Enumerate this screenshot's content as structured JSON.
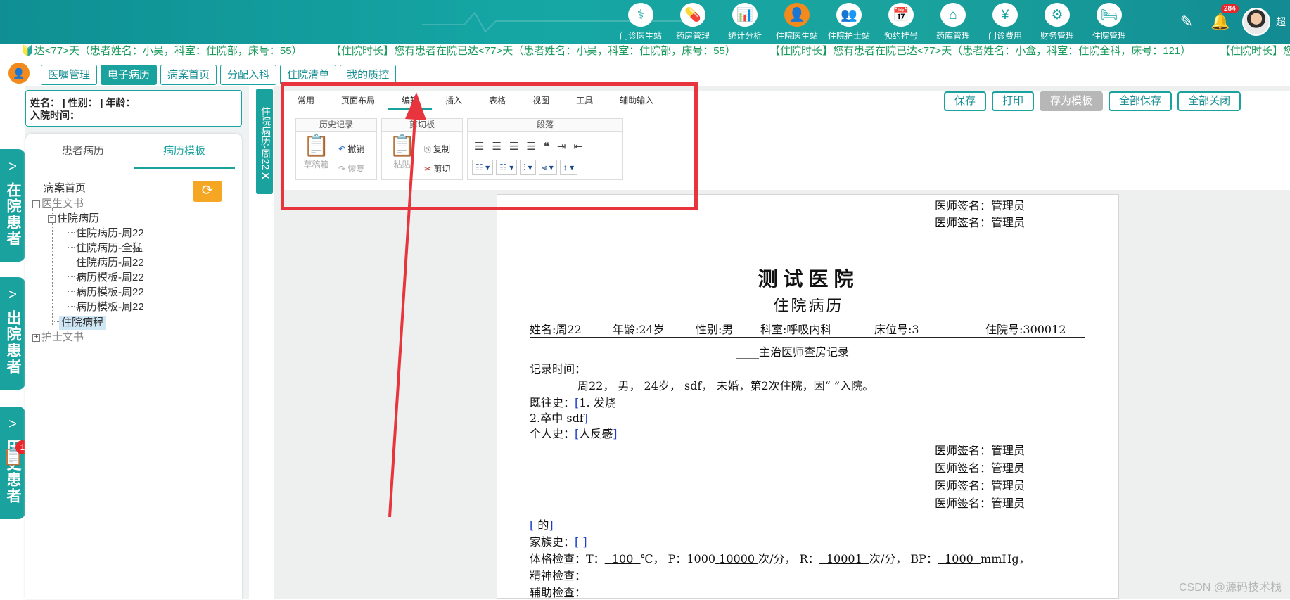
{
  "header": {
    "nav": [
      {
        "label": "门诊医生站",
        "icon": "doctor-icon",
        "glyph": "⚕",
        "active": false
      },
      {
        "label": "药房管理",
        "icon": "pill-icon",
        "glyph": "💊",
        "active": false
      },
      {
        "label": "统计分析",
        "icon": "chart-icon",
        "glyph": "📊",
        "active": false
      },
      {
        "label": "住院医生站",
        "icon": "user-card-icon",
        "glyph": "👤",
        "active": true
      },
      {
        "label": "住院护士站",
        "icon": "nurse-icon",
        "glyph": "👥",
        "active": false
      },
      {
        "label": "预约挂号",
        "icon": "calendar-icon",
        "glyph": "📅",
        "active": false
      },
      {
        "label": "药库管理",
        "icon": "warehouse-icon",
        "glyph": "⌂",
        "active": false
      },
      {
        "label": "门诊费用",
        "icon": "yen-icon",
        "glyph": "¥",
        "active": false
      },
      {
        "label": "财务管理",
        "icon": "gear-icon",
        "glyph": "⚙",
        "active": false
      },
      {
        "label": "住院管理",
        "icon": "bed-icon",
        "glyph": "🛏",
        "active": false
      }
    ],
    "notif_count": "284",
    "username": "超"
  },
  "marquee": [
    "🔰达<77>天（患者姓名：小吴，科室：住院部，床号：55）",
    "【住院时长】您有患者在院已达<77>天（患者姓名：小吴，科室：住院部，床号：55）",
    "【住院时长】您有患者在院已达<77>天（患者姓名：小盒，科室：住院全科，床号：121）",
    "【住院时长】您有"
  ],
  "subtabs": [
    {
      "label": "医嘱管理",
      "active": false
    },
    {
      "label": "电子病历",
      "active": true
    },
    {
      "label": "病案首页",
      "active": false
    },
    {
      "label": "分配入科",
      "active": false
    },
    {
      "label": "住院清单",
      "active": false
    },
    {
      "label": "我的质控",
      "active": false
    }
  ],
  "side": {
    "tabs": [
      {
        "label": "在院患者"
      },
      {
        "label": "出院患者"
      },
      {
        "label": "历史患者"
      }
    ],
    "clip_badge": "1"
  },
  "patient": {
    "line1": "姓名：  | 性别：  | 年龄：",
    "line2": "入院时间："
  },
  "panel": {
    "tabs": [
      {
        "label": "患者病历",
        "active": false
      },
      {
        "label": "病历模板",
        "active": true
      }
    ],
    "tree": [
      {
        "label": "病案首页"
      },
      {
        "label": "医生文书"
      },
      {
        "label": "住院病历"
      },
      {
        "label": "住院病历-周22"
      },
      {
        "label": "住院病历-全猛"
      },
      {
        "label": "住院病历-周22"
      },
      {
        "label": "病历模板-周22"
      },
      {
        "label": "病历模板-周22"
      },
      {
        "label": "病历模板-周22"
      },
      {
        "label": "住院病程"
      },
      {
        "label": "护士文书"
      }
    ]
  },
  "doc_tab": {
    "label": "住院病历-周22",
    "close": "X"
  },
  "ribbon": {
    "tabs": [
      "常用",
      "页面布局",
      "编辑",
      "插入",
      "表格",
      "视图",
      "工具",
      "辅助输入"
    ],
    "active_tab": "编辑",
    "groups": {
      "history": {
        "title": "历史记录",
        "draft": "草稿箱",
        "undo": "撤销",
        "redo": "恢复"
      },
      "clipboard": {
        "title": "剪切板",
        "paste": "粘贴",
        "copy": "复制",
        "cut": "剪切"
      },
      "paragraph": {
        "title": "段落"
      }
    }
  },
  "actions": [
    {
      "label": "保存",
      "disabled": false
    },
    {
      "label": "打印",
      "disabled": false
    },
    {
      "label": "存为模板",
      "disabled": true
    },
    {
      "label": "全部保存",
      "disabled": false
    },
    {
      "label": "全部关闭",
      "disabled": false
    }
  ],
  "doc": {
    "signer_label": "医师签名：",
    "signer": "管理员",
    "hospital": "测试医院",
    "title": "住院病历",
    "info": {
      "name": "姓名:周22",
      "age": "年龄:24岁",
      "gender": "性别:男",
      "dept": "科室:呼吸内科",
      "bed": "床位号:3",
      "inpatient_no": "住院号:300012"
    },
    "round_title": "主治医师查房记录",
    "record_time": "记录时间：",
    "summary": "周22， 男， 24岁， sdf， 未婚，第2次住院，因“ ”入院。",
    "past_history_label": "既往史：",
    "past_history_1": "1. 发烧",
    "past_history_2": "2.卒中 sdf",
    "personal_label": "个人史：",
    "personal_value": "人反感",
    "de": "的",
    "family_label": "家族史：",
    "exam": {
      "label": "体格检查：T：",
      "t": "100",
      "t_unit": "℃， P：1000",
      "p": "10000",
      "p_unit": "次/分， R：",
      "r": "10001",
      "r_unit": "次/分， BP：",
      "bp": "1000",
      "bp_unit": "mmHg，"
    },
    "mental_label": "精神检查：",
    "aux_label": "辅助检查："
  },
  "watermark": "CSDN @源码技术栈"
}
